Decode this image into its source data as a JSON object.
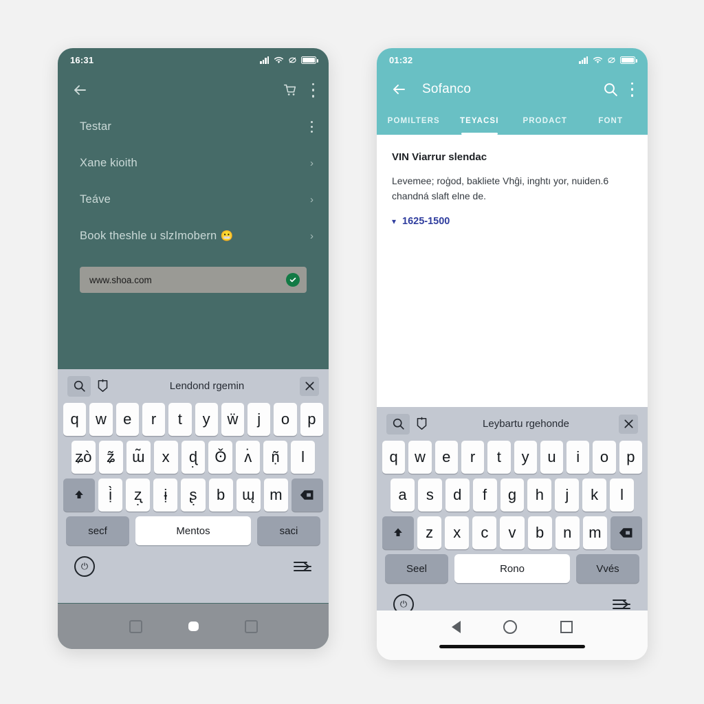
{
  "left_phone": {
    "status_bar": {
      "time": "16:31",
      "icons": [
        "signal-icon",
        "wifi-icon",
        "nfc-icon",
        "battery-icon"
      ]
    },
    "app_bar": {
      "back_icon": "back-arrow-icon",
      "cart_icon": "cart-icon",
      "overflow_icon": "more-vertical-icon"
    },
    "list_items": [
      {
        "label": "Testar",
        "trailing": "more-vertical-icon"
      },
      {
        "label": "Xane kioith",
        "trailing": "chevron-right"
      },
      {
        "label": "Teáve",
        "trailing": "chevron-right"
      },
      {
        "label": "Book theshle u slzImobern",
        "emoji": "😬",
        "trailing": "chevron-right"
      }
    ],
    "url_field": {
      "value": "www.shoa.com",
      "status_icon": "check-circle-icon"
    },
    "keyboard": {
      "toolbar": {
        "search_icon": "search-icon",
        "sticker_icon": "sticker-icon",
        "hint": "Lendond rgemin",
        "close_icon": "close-icon"
      },
      "row1": [
        "q",
        "w",
        "e",
        "r",
        "t",
        "y",
        "ẅ",
        "j",
        "o",
        "p"
      ],
      "row2": [
        "ʑò",
        "ʑ̃",
        "ɯ̃",
        "x",
        "ɖ̣",
        "ʘ̌",
        "ʌ̇",
        "ṇ̃",
        "l"
      ],
      "row3": [
        "ị̀",
        "ʐ̣",
        "ɨ̣",
        "ʂ̣",
        "b",
        "ɯ̨",
        "m"
      ],
      "shift_icon": "shift-icon",
      "backspace_icon": "backspace-icon",
      "bottom": {
        "left_key": "secf",
        "space_key": "Mentos",
        "right_key": "saci"
      },
      "footer": {
        "left_icon": "power-icon",
        "right_icon": "text-lines-icon"
      }
    },
    "nav_bar": [
      "square-icon",
      "home-dot-icon",
      "square-icon"
    ],
    "colors": {
      "surface": "#466b68",
      "keyboard": "#c3c8d1",
      "navbar": "#8e9297",
      "check": "#127a45"
    }
  },
  "right_phone": {
    "status_bar": {
      "time": "01:32",
      "icons": [
        "signal-icon",
        "wifi-icon",
        "nfc-icon",
        "battery-icon"
      ]
    },
    "app_bar": {
      "back_icon": "back-arrow-icon",
      "title": "Sofanco",
      "search_icon": "search-icon",
      "overflow_icon": "more-vertical-icon"
    },
    "tabs": [
      {
        "label": "POMILTERS",
        "active": false
      },
      {
        "label": "TEYACSI",
        "active": true
      },
      {
        "label": "PRODACT",
        "active": false
      },
      {
        "label": "FONT",
        "active": false
      }
    ],
    "content": {
      "heading": "VIN Viarrur slendac",
      "paragraph": "Levemee; roģod, bakliete Vhĝi, inghtı yor, nuiden.6 chandná slaft elne de.",
      "link": {
        "chevron": "chevron-down-icon",
        "label": "1625-1500"
      }
    },
    "keyboard": {
      "toolbar": {
        "search_icon": "search-icon",
        "sticker_icon": "sticker-icon",
        "hint": "Leybartu rgehonde",
        "close_icon": "close-icon"
      },
      "row1": [
        "q",
        "w",
        "e",
        "r",
        "t",
        "y",
        "u",
        "i",
        "o",
        "p"
      ],
      "row2": [
        "a",
        "s",
        "d",
        "f",
        "g",
        "h",
        "j",
        "k",
        "l"
      ],
      "row3": [
        "z",
        "x",
        "c",
        "v",
        "b",
        "n",
        "m"
      ],
      "shift_icon": "shift-icon",
      "backspace_icon": "backspace-icon",
      "bottom": {
        "left_key": "Seel",
        "space_key": "Rono",
        "right_key": "Vvés"
      },
      "footer": {
        "left_icon": "power-icon",
        "right_icon": "text-lines-icon"
      }
    },
    "nav_bar": [
      "back-triangle-icon",
      "home-circle-icon",
      "recents-square-icon",
      "gesture-bar"
    ],
    "colors": {
      "header": "#69c0c4",
      "surface": "#ffffff",
      "link": "#2f3d9e",
      "keyboard": "#c3c8d1"
    }
  }
}
